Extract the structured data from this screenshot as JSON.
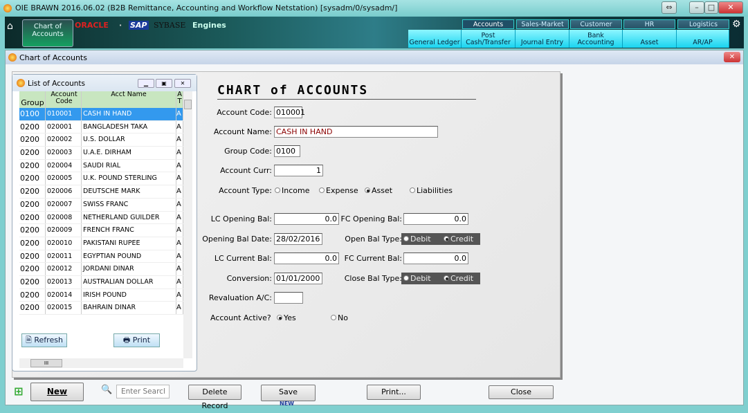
{
  "window": {
    "title": "OIE BRAWN 2016.06.02 (B2B Remittance, Accounting and Workflow Netstation) [sysadm/0/sysadm/]",
    "btn_resize": "⇔",
    "btn_min": "–",
    "btn_max": "□",
    "btn_close": "✕"
  },
  "banner": {
    "tile": "Chart of Accounts",
    "brands": [
      "ORACLE",
      "·",
      "SAP",
      "SYBASE",
      "Engines"
    ]
  },
  "modules": {
    "tabs": [
      "Accounts",
      "Sales-Market",
      "Customer",
      "HR",
      "Logistics"
    ],
    "subs": [
      "General Ledger",
      "Post Cash/Transfer",
      "Journal Entry",
      "Bank Accounting",
      "Asset",
      "AR/AP"
    ]
  },
  "child": {
    "title": "Chart of Accounts",
    "close": "✕"
  },
  "list": {
    "title": "List of Accounts",
    "headers": [
      "Group",
      "Account Code",
      "Acct Name",
      "A T"
    ],
    "rows": [
      [
        "0100",
        "010001",
        "CASH IN HAND",
        "A"
      ],
      [
        "0200",
        "020001",
        "BANGLADESH TAKA",
        "A"
      ],
      [
        "0200",
        "020002",
        "U.S. DOLLAR",
        "A"
      ],
      [
        "0200",
        "020003",
        "U.A.E. DIRHAM",
        "A"
      ],
      [
        "0200",
        "020004",
        "SAUDI RIAL",
        "A"
      ],
      [
        "0200",
        "020005",
        "U.K. POUND STERLING",
        "A"
      ],
      [
        "0200",
        "020006",
        "DEUTSCHE MARK",
        "A"
      ],
      [
        "0200",
        "020007",
        "SWISS FRANC",
        "A"
      ],
      [
        "0200",
        "020008",
        "NETHERLAND GUILDER",
        "A"
      ],
      [
        "0200",
        "020009",
        "FRENCH FRANC",
        "A"
      ],
      [
        "0200",
        "020010",
        "PAKISTANI RUPEE",
        "A"
      ],
      [
        "0200",
        "020011",
        "EGYPTIAN POUND",
        "A"
      ],
      [
        "0200",
        "020012",
        "JORDANI DINAR",
        "A"
      ],
      [
        "0200",
        "020013",
        "AUSTRALIAN DOLLAR",
        "A"
      ],
      [
        "0200",
        "020014",
        "IRISH POUND",
        "A"
      ],
      [
        "0200",
        "020015",
        "BAHRAIN DINAR",
        "A"
      ]
    ],
    "refresh": "Refresh",
    "print": "Print",
    "hscroll_grip": "III"
  },
  "form": {
    "heading": "CHART of ACCOUNTS",
    "account_code_label": "Account Code:",
    "account_code": "010001",
    "account_name_label": "Account Name:",
    "account_name": "CASH IN HAND",
    "group_code_label": "Group Code:",
    "group_code": "0100",
    "account_curr_label": "Account Curr:",
    "account_curr": "1",
    "account_type_label": "Account Type:",
    "account_types": [
      "Income",
      "Expense",
      "Asset",
      "Liabilities"
    ],
    "account_type_selected": "Asset",
    "lc_open_label": "LC Opening Bal:",
    "lc_open": "0.0",
    "fc_open_label": "FC Opening Bal:",
    "fc_open": "0.0",
    "open_date_label": "Opening Bal Date:",
    "open_date": "28/02/2016",
    "open_type_label": "Open Bal Type:",
    "lc_cur_label": "LC Current Bal:",
    "lc_cur": "0.0",
    "fc_cur_label": "FC Current Bal:",
    "fc_cur": "0.0",
    "conversion_label": "Conversion:",
    "conversion": "01/01/2000",
    "close_type_label": "Close Bal Type:",
    "debit": "Debit",
    "credit": "Credit",
    "bal_type_selected": "Credit",
    "reval_label": "Revaluation A/C:",
    "reval": "",
    "active_label": "Account Active?",
    "yes": "Yes",
    "no": "No",
    "active_selected": "Yes"
  },
  "footer": {
    "new": "New",
    "search_placeholder": "Enter Search",
    "delete": "Delete Record",
    "save": "Save",
    "save_mode": "NEW",
    "print": "Print...",
    "close": "Close"
  },
  "colors": {
    "selection": "#3399ee",
    "account_name_text": "#8b0000",
    "module_accent": "#19d4f0"
  }
}
